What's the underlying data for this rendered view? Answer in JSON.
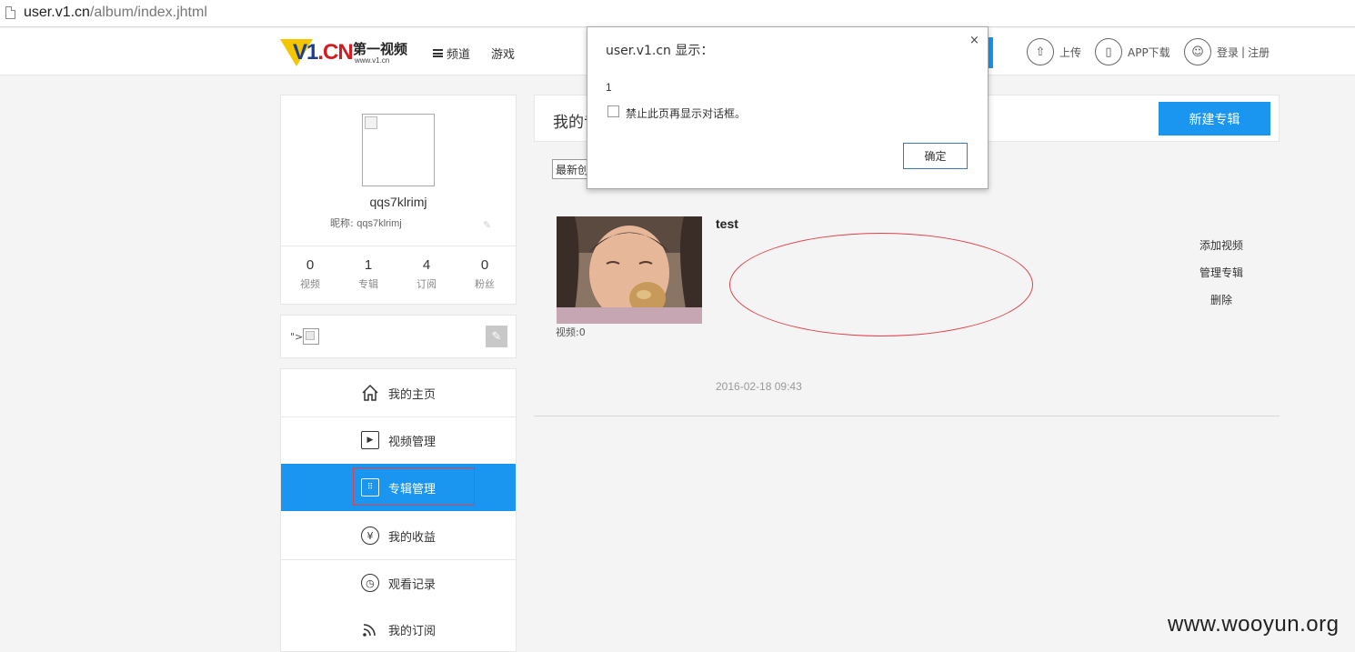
{
  "browser": {
    "url_host": "user.v1.cn",
    "url_path": "/album/index.jhtml"
  },
  "header": {
    "logo_text_v1": "V1",
    "logo_text_cn": ".CN",
    "site_name": "第一视频",
    "site_url": "www.v1.cn",
    "nav_channel": "频道",
    "nav_game": "游戏",
    "upload": "上传",
    "app_download": "APP下载",
    "login": "登录",
    "register": "注册",
    "login_sep": "|"
  },
  "profile": {
    "username": "qqs7klrimj",
    "nickname_label": "昵称:",
    "nickname_value": "qqs7klrimj",
    "stats": [
      {
        "num": "0",
        "label": "视频"
      },
      {
        "num": "1",
        "label": "专辑"
      },
      {
        "num": "4",
        "label": "订阅"
      },
      {
        "num": "0",
        "label": "粉丝"
      }
    ],
    "signature_prefix": "\">"
  },
  "menu": [
    {
      "label": "我的主页",
      "icon": "home-icon"
    },
    {
      "label": "视频管理",
      "icon": "play-icon"
    },
    {
      "label": "专辑管理",
      "icon": "album-grid-icon",
      "active": true
    },
    {
      "label": "我的收益",
      "icon": "yen-icon"
    },
    {
      "label": "观看记录",
      "icon": "clock-icon"
    },
    {
      "label": "我的订阅",
      "icon": "rss-icon"
    }
  ],
  "album_section": {
    "title": "我的专辑",
    "new_album_button": "新建专辑",
    "sort_selected": "最新创建"
  },
  "album": {
    "name": "test",
    "video_count": "视频:0",
    "date": "2016-02-18 09:43",
    "actions": [
      "添加视频",
      "管理专辑",
      "删除"
    ]
  },
  "dialog": {
    "title": "user.v1.cn 显示：",
    "close": "×",
    "message": "1",
    "checkbox_label": "禁止此页再显示对话框。",
    "ok_button": "确定"
  },
  "watermark": "www.wooyun.org",
  "colors": {
    "accent": "#1a96f0",
    "annotation_red": "#e0404a"
  }
}
